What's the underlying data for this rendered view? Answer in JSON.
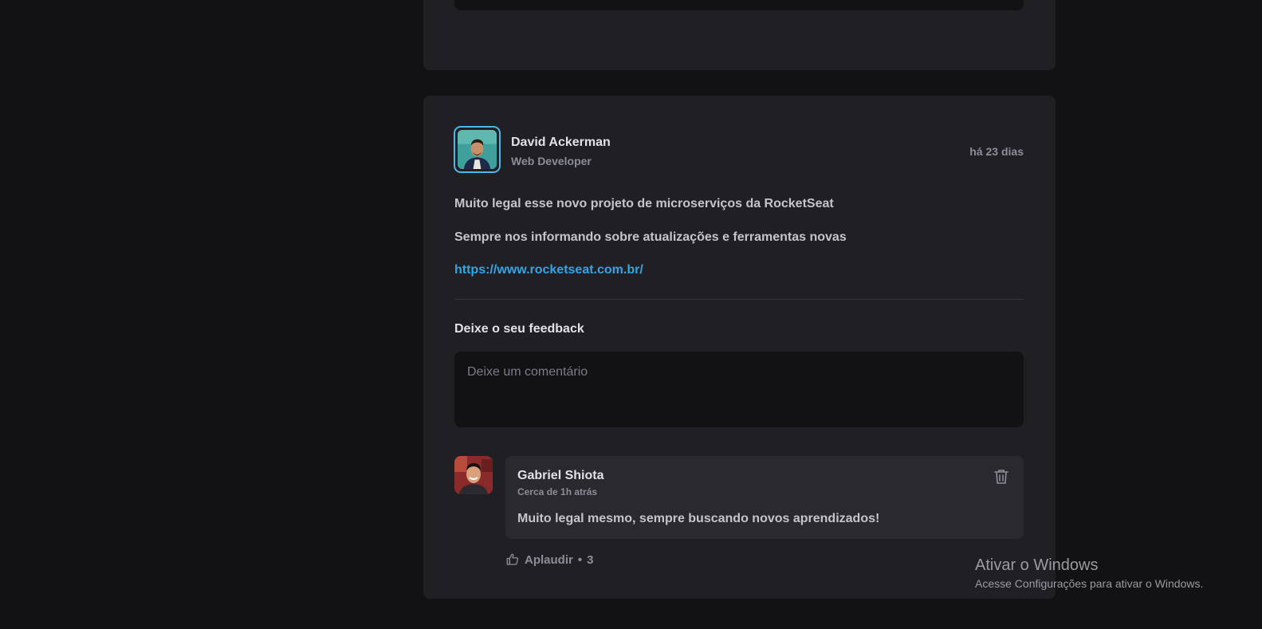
{
  "post": {
    "author": {
      "name": "David Ackerman",
      "role": "Web Developer"
    },
    "published_relative": "há 23 dias",
    "content": [
      "Muito legal esse novo projeto de microserviços da RocketSeat",
      "Sempre nos informando sobre atualizações e ferramentas novas"
    ],
    "link": "https://www.rocketseat.com.br/",
    "feedback": {
      "title": "Deixe o seu feedback",
      "placeholder": "Deixe um comentário",
      "value": ""
    }
  },
  "comments": [
    {
      "author": "Gabriel Shiota",
      "time": "Cerca de 1h atrás",
      "text": "Muito legal mesmo, sempre buscando novos aprendizados!",
      "applaud_label": "Aplaudir",
      "applaud_separator": "•",
      "applaud_count": "3"
    }
  ],
  "icons": {
    "trash": "trash-icon",
    "thumbs_up": "thumbs-up-icon"
  },
  "colors": {
    "accent": "#31a5e8",
    "avatar_border": "#4fb7e8",
    "background": "#121214",
    "card": "#202024",
    "comment_card": "#29292e"
  },
  "watermark": {
    "title": "Ativar o Windows",
    "subtitle": "Acesse Configurações para ativar o Windows."
  }
}
